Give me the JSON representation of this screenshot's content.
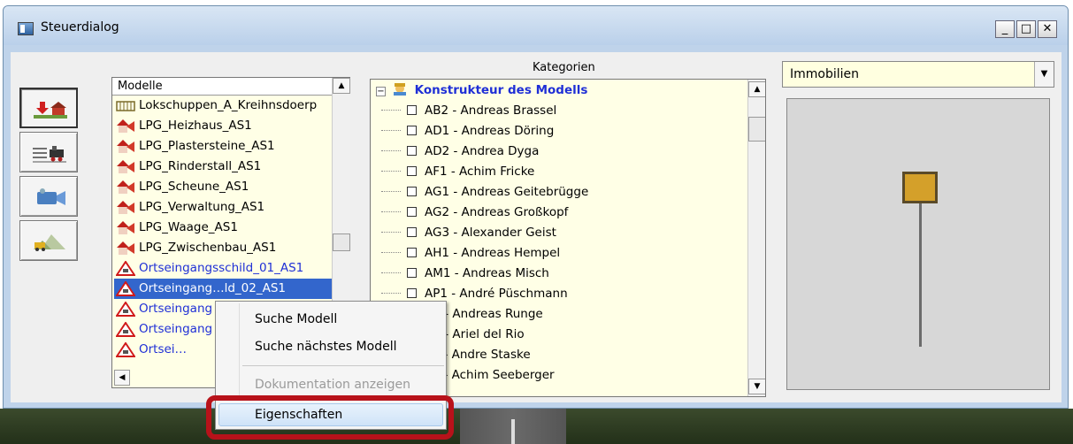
{
  "window": {
    "title": "Steuerdialog",
    "min": "_",
    "max": "□",
    "close": "✕"
  },
  "models": {
    "header": "Modelle",
    "items": [
      {
        "label": "Lokschuppen_A_Kreihnsdoerp",
        "icon": "shed-icon",
        "style": "normal"
      },
      {
        "label": "LPG_Heizhaus_AS1",
        "icon": "house-icon",
        "style": "normal"
      },
      {
        "label": "LPG_Plastersteine_AS1",
        "icon": "house-icon",
        "style": "normal"
      },
      {
        "label": "LPG_Rinderstall_AS1",
        "icon": "house-icon",
        "style": "normal"
      },
      {
        "label": "LPG_Scheune_AS1",
        "icon": "house-icon",
        "style": "normal"
      },
      {
        "label": "LPG_Verwaltung_AS1",
        "icon": "house-icon",
        "style": "normal"
      },
      {
        "label": "LPG_Waage_AS1",
        "icon": "house-icon",
        "style": "normal"
      },
      {
        "label": "LPG_Zwischenbau_AS1",
        "icon": "house-icon",
        "style": "normal"
      },
      {
        "label": "Ortseingangsschild_01_AS1",
        "icon": "warning-sign-icon",
        "style": "blue"
      },
      {
        "label": "Ortseingang…ld_02_AS1",
        "icon": "warning-sign-icon",
        "style": "selected"
      },
      {
        "label": "Ortseingang",
        "icon": "warning-sign-icon",
        "style": "blue"
      },
      {
        "label": "Ortseingang",
        "icon": "warning-sign-icon",
        "style": "blue"
      },
      {
        "label": "Ortsei…",
        "icon": "warning-sign-icon",
        "style": "blue"
      }
    ]
  },
  "categories": {
    "caption": "Kategorien",
    "root": "Konstrukteur des Modells",
    "items": [
      "AB2 - Andreas Brassel",
      "AD1 - Andreas Döring",
      "AD2 - Andrea Dyga",
      "AF1 - Achim Fricke",
      "AG1 - Andreas Geitebrügge",
      "AG2 - Andreas Großkopf",
      "AG3 - Alexander Geist",
      "AH1 - Andreas Hempel",
      "AM1 - Andreas Misch",
      "AP1 - André Püschmann",
      "R1 - Andreas Runge",
      "R3 - Ariel del Rio",
      "S1 - Andre Staske",
      "S2 - Achim Seeberger"
    ]
  },
  "filter": {
    "selected": "Immobilien"
  },
  "context_menu": {
    "items": [
      "Suche Modell",
      "Suche nächstes Modell",
      "Dokumentation anzeigen",
      "Eigenschaften"
    ],
    "disabled": [
      "Dokumentation anzeigen"
    ]
  },
  "tools": [
    "insert-objects-icon",
    "track-layout-icon",
    "camera-icon",
    "terrain-icon"
  ],
  "colors": {
    "highlight_border": "#b8121a",
    "selection": "#3366cc",
    "link_blue": "#1f2fd6"
  }
}
